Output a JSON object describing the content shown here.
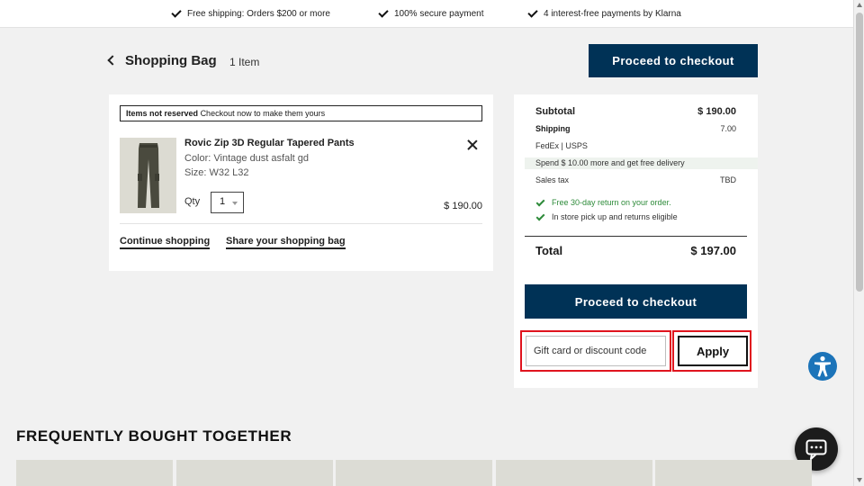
{
  "usp_bar": {
    "items": [
      "Free shipping: Orders $200 or more",
      "100% secure payment",
      "4 interest-free payments by Klarna"
    ]
  },
  "header": {
    "title": "Shopping Bag",
    "item_count": "1 Item",
    "checkout_label": "Proceed to checkout"
  },
  "cart": {
    "notice_bold": "Items not reserved",
    "notice_text": "Checkout now to make them yours",
    "item": {
      "name": "Rovic Zip 3D Regular Tapered Pants",
      "color": "Color: Vintage dust asfalt gd",
      "size": "Size: W32 L32",
      "qty_label": "Qty",
      "qty_value": "1",
      "price": "$ 190.00"
    },
    "continue_label": "Continue shopping",
    "share_label": "Share your shopping bag"
  },
  "summary": {
    "subtotal_label": "Subtotal",
    "subtotal_value": "$ 190.00",
    "shipping_label": "Shipping",
    "shipping_value": "7.00",
    "carrier": "FedEx | USPS",
    "free_delivery_notice": "Spend $ 10.00 more and get free delivery",
    "tax_label": "Sales tax",
    "tax_value": "TBD",
    "perk_return": "Free 30-day return on your order.",
    "perk_pickup": "In store pick up and returns eligible",
    "total_label": "Total",
    "total_value": "$ 197.00",
    "checkout_label": "Proceed to checkout",
    "discount_placeholder": "Gift card or discount code",
    "apply_label": "Apply"
  },
  "recommendations": {
    "title": "FREQUENTLY BOUGHT TOGETHER"
  },
  "colors": {
    "primary": "#003256",
    "highlight_red": "#e0141e",
    "success_green": "#2e8b3a",
    "accessibility_blue": "#1c74b9"
  }
}
